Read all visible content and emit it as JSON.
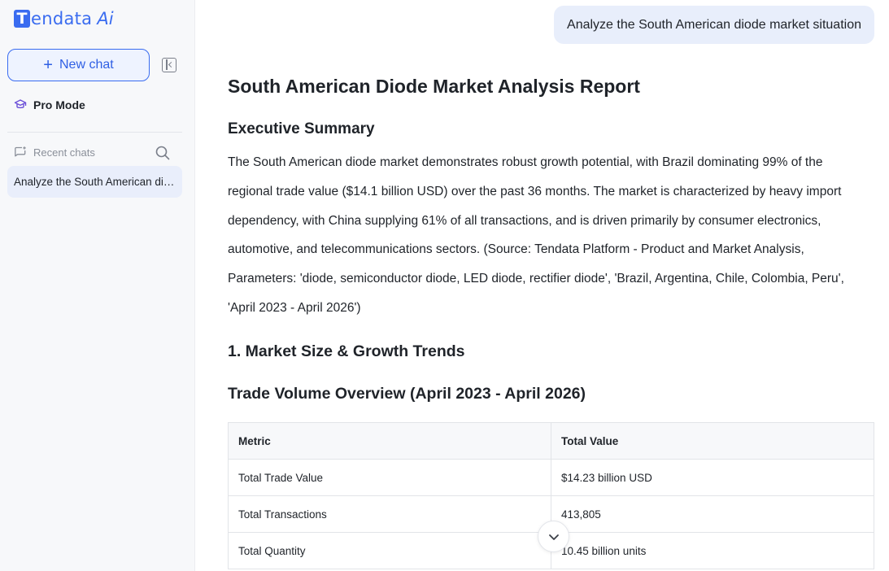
{
  "app": {
    "logo_t": "T",
    "logo_rest": "endata",
    "logo_ai": "Ai"
  },
  "sidebar": {
    "new_chat_label": "New chat",
    "pro_mode_label": "Pro Mode",
    "recent_chats_label": "Recent chats",
    "chats": [
      {
        "title": "Analyze the South American diode market situation"
      }
    ]
  },
  "conversation": {
    "user_message": "Analyze the South American diode market situation",
    "report": {
      "title": "South American Diode Market Analysis Report",
      "executive_summary_heading": "Executive Summary",
      "executive_summary_text": "The South American diode market demonstrates robust growth potential, with Brazil dominating 99% of the regional trade value ($14.1 billion USD) over the past 36 months. The market is characterized by heavy import dependency, with China supplying 61% of all transactions, and is driven primarily by consumer electronics, automotive, and telecommunications sectors. (Source: Tendata Platform - Product and Market Analysis, Parameters: 'diode, semiconductor diode, LED diode, rectifier diode', 'Brazil, Argentina, Chile, Colombia, Peru', 'April 2023 - April 2026')",
      "section1_heading": "1. Market Size & Growth Trends",
      "trade_volume_heading": "Trade Volume Overview (April 2023 - April 2026)",
      "table": {
        "headers": [
          "Metric",
          "Total Value"
        ],
        "rows": [
          [
            "Total Trade Value",
            "$14.23 billion USD"
          ],
          [
            "Total Transactions",
            "413,805"
          ],
          [
            "Total Quantity",
            "10.45 billion units"
          ]
        ]
      }
    }
  },
  "colors": {
    "accent": "#3a6cf0",
    "user_bubble": "#e8eefb",
    "sidebar_bg": "#f7f8fa"
  }
}
